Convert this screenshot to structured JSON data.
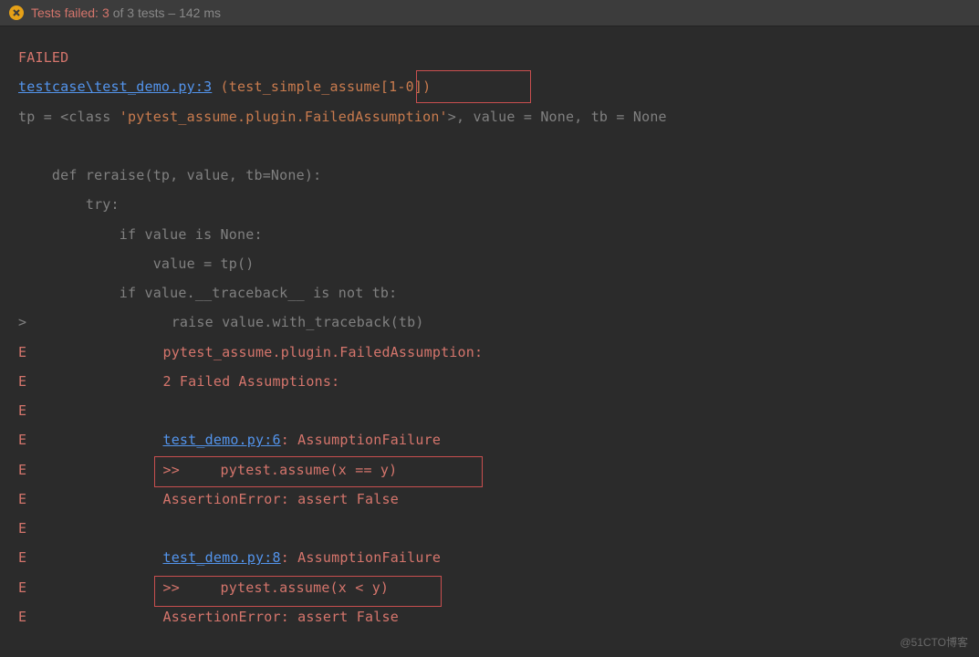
{
  "header": {
    "fail_label": "Tests failed:",
    "fail_count": "3",
    "rest": "of 3 tests – 142 ms"
  },
  "trace": {
    "failed": "FAILED",
    "file_link": "testcase\\test_demo.py:3",
    "test_name": " (test_simple_assume[1-0])",
    "tp_line_a": "tp = <class ",
    "tp_line_b": "'pytest_assume.plugin.FailedAssumption'",
    "tp_line_c": ">, value = None, tb = None",
    "def_line": "    def reraise(tp, value, tb=None):",
    "try_line": "        try:",
    "if1": "            if value is None:",
    "val1": "                value = tp()",
    "if2": "            if value.__traceback__ is not tb:",
    "raise": "                raise value.with_traceback(tb)",
    "err1": "               pytest_assume.plugin.FailedAssumption:",
    "err2": "               2 Failed Assumptions:",
    "link1": "test_demo.py:6",
    "af1": ": AssumptionFailure",
    "assume1": "               >>\tpytest.assume(x == y)",
    "ae": "               AssertionError: assert False",
    "link2": "test_demo.py:8",
    "assume2": "               >>\tpytest.assume(x < y)"
  },
  "watermark": "@51CTO博客"
}
